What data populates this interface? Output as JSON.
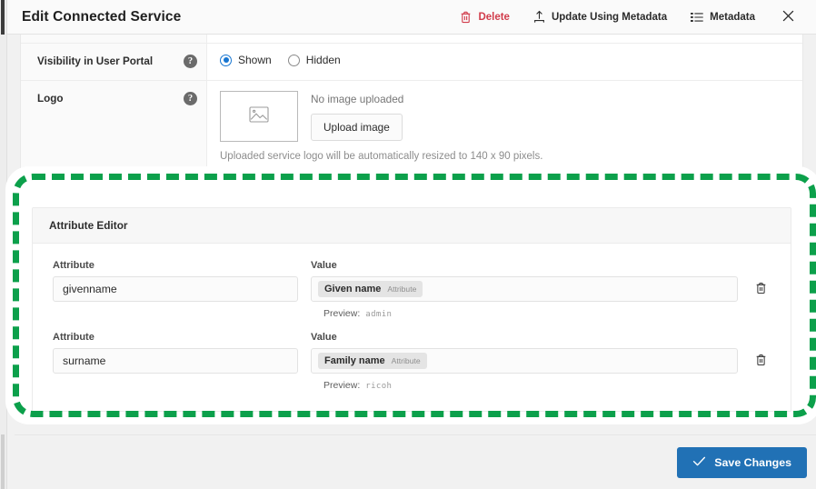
{
  "header": {
    "title": "Edit Connected Service",
    "actions": [
      {
        "label": "Delete",
        "icon": "trash-icon",
        "style": "danger"
      },
      {
        "label": "Update Using Metadata",
        "icon": "upload-icon",
        "style": "normal"
      },
      {
        "label": "Metadata",
        "icon": "list-icon",
        "style": "normal"
      }
    ],
    "close_icon": "close-icon"
  },
  "form": {
    "rows": [
      {
        "label": "Visibility in User Portal",
        "help": "?",
        "type": "radio",
        "options": [
          {
            "label": "Shown",
            "selected": true
          },
          {
            "label": "Hidden",
            "selected": false
          }
        ]
      },
      {
        "label": "Logo",
        "help": "?",
        "type": "logo",
        "placeholder_icon": "image-placeholder-icon",
        "status_text": "No image uploaded",
        "upload_label": "Upload image",
        "hint": "Uploaded service logo will be automatically resized to 140 x 90 pixels."
      }
    ]
  },
  "attribute_editor": {
    "title": "Attribute Editor",
    "column_labels": {
      "attribute": "Attribute",
      "value": "Value"
    },
    "preview_label": "Preview:",
    "delete_icon": "trash-icon",
    "rows": [
      {
        "attribute": "givenname",
        "chip_name": "Given name",
        "chip_tag": "Attribute",
        "preview": "admin"
      },
      {
        "attribute": "surname",
        "chip_name": "Family name",
        "chip_tag": "Attribute",
        "preview": "ricoh"
      }
    ]
  },
  "footer": {
    "save_label": "Save Changes",
    "save_icon": "check-icon"
  },
  "annotation": {
    "type": "dashed-rectangle-highlight",
    "color": "#0ca04b",
    "target": "attribute-editor"
  },
  "colors": {
    "accent_blue": "#2171b5",
    "danger_red": "#d13c4b",
    "highlight_green": "#0ca04b"
  }
}
